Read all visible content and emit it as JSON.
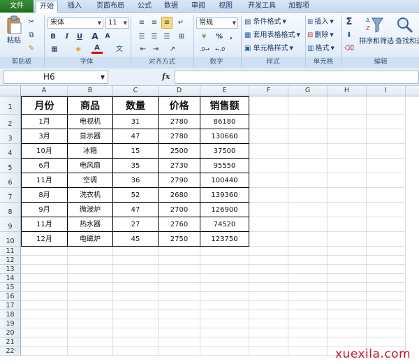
{
  "tabs": [
    "文件",
    "开始",
    "插入",
    "页面布局",
    "公式",
    "数据",
    "审阅",
    "视图",
    "开发工具",
    "加载项"
  ],
  "ribbon": {
    "clipboard": {
      "paste_label": "粘贴",
      "group_label": "剪贴板"
    },
    "font": {
      "font_name": "宋体",
      "font_size": "11",
      "bold": "B",
      "italic": "I",
      "underline": "U",
      "grow": "A",
      "shrink": "A",
      "group_label": "字体"
    },
    "alignment": {
      "group_label": "对齐方式"
    },
    "number": {
      "format": "常规",
      "percent": "%",
      "comma": ",",
      "group_label": "数字"
    },
    "styles": {
      "conditional": "条件格式",
      "table": "套用表格格式",
      "cell_styles": "单元格样式",
      "group_label": "样式"
    },
    "cells": {
      "insert": "插入",
      "delete": "删除",
      "format": "格式",
      "group_label": "单元格"
    },
    "editing": {
      "sum": "Σ",
      "sort_filter": "排序和筛选",
      "find_select": "查找和选",
      "group_label": "编辑"
    }
  },
  "formula_bar": {
    "cell_ref": "H6",
    "fx": "fx",
    "formula": ""
  },
  "sheet": {
    "columns": [
      "A",
      "B",
      "C",
      "D",
      "E",
      "F",
      "G",
      "H",
      "I"
    ],
    "rows": [
      "1",
      "2",
      "3",
      "4",
      "5",
      "6",
      "7",
      "8",
      "9",
      "10",
      "11",
      "12",
      "13",
      "14",
      "15",
      "16",
      "17",
      "18",
      "19",
      "20",
      "21",
      "22"
    ],
    "header": [
      "月份",
      "商品",
      "数量",
      "价格",
      "销售额"
    ],
    "data": [
      [
        "1月",
        "电视机",
        "31",
        "2780",
        "86180"
      ],
      [
        "3月",
        "显示器",
        "47",
        "2780",
        "130660"
      ],
      [
        "10月",
        "冰箱",
        "15",
        "2500",
        "37500"
      ],
      [
        "6月",
        "电风扇",
        "35",
        "2730",
        "95550"
      ],
      [
        "11月",
        "空调",
        "36",
        "2790",
        "100440"
      ],
      [
        "8月",
        "洗衣机",
        "52",
        "2680",
        "139360"
      ],
      [
        "9月",
        "微波炉",
        "47",
        "2700",
        "126900"
      ],
      [
        "11月",
        "热水器",
        "27",
        "2760",
        "74520"
      ],
      [
        "12月",
        "电磁炉",
        "45",
        "2750",
        "123750"
      ]
    ]
  },
  "watermark": "xuexila.com"
}
